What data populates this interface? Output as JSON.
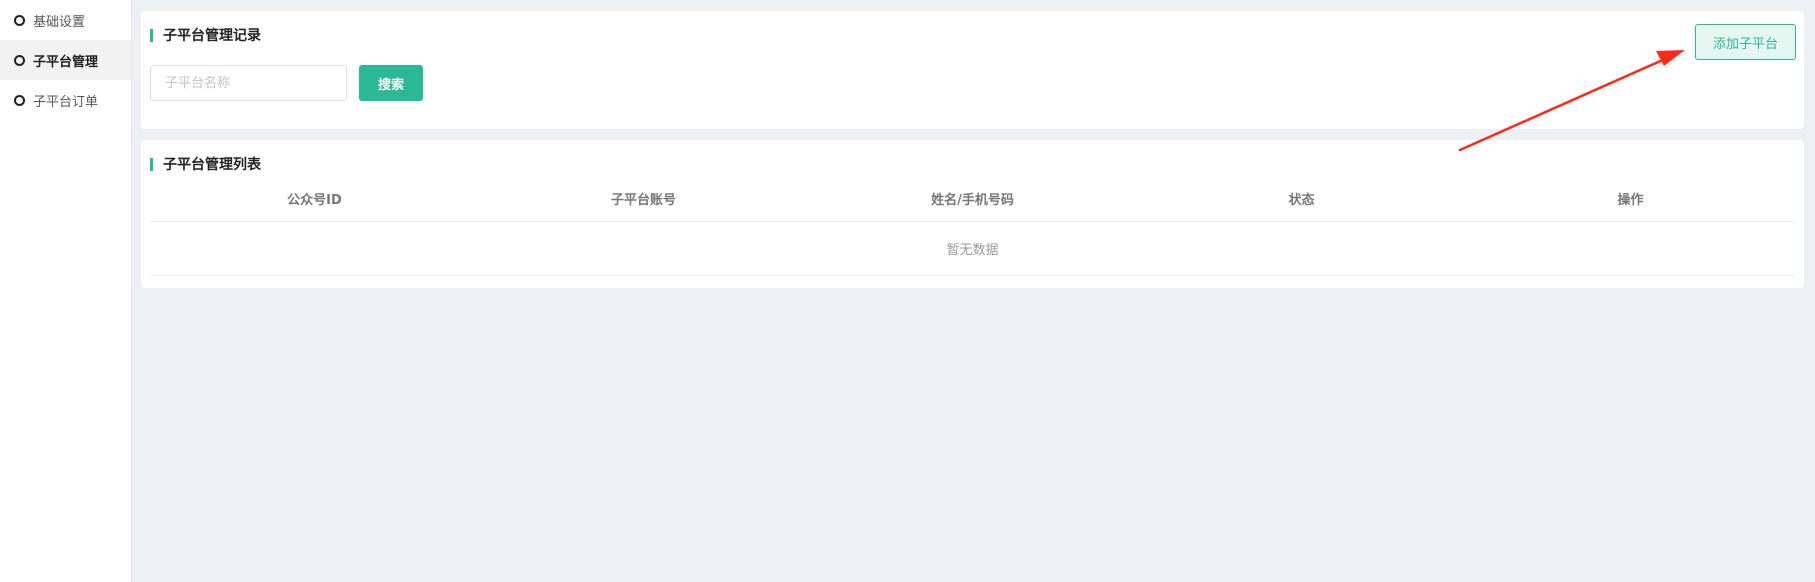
{
  "sidebar": {
    "items": [
      {
        "label": "基础设置",
        "active": false
      },
      {
        "label": "子平台管理",
        "active": true
      },
      {
        "label": "子平台订单",
        "active": false
      }
    ]
  },
  "search_section": {
    "title": "子平台管理记录",
    "search_placeholder": "子平台名称",
    "search_value": "",
    "search_button": "搜索",
    "add_button": "添加子平台"
  },
  "list_section": {
    "title": "子平台管理列表",
    "columns": [
      "公众号ID",
      "子平台账号",
      "姓名/手机号码",
      "状态",
      "操作"
    ],
    "empty_text": "暂无数据"
  },
  "colors": {
    "accent": "#2bb894",
    "annotation_arrow": "#ff2a1a"
  }
}
